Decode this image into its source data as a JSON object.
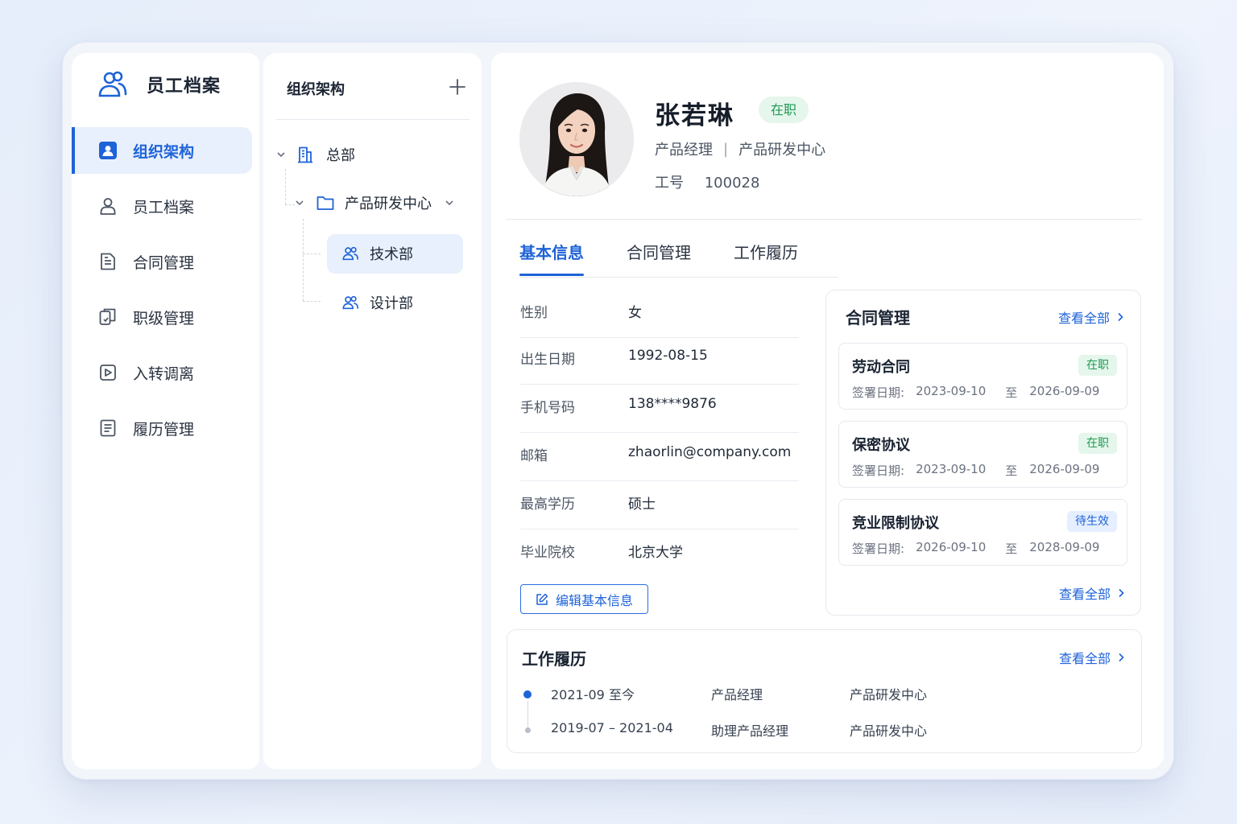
{
  "app": {
    "title": "员工档案",
    "brand_icon": "users-icon",
    "accent": "#1e63d8"
  },
  "sidebar": {
    "items": [
      {
        "label": "组织架构",
        "icon": "org-icon",
        "active": true
      },
      {
        "label": "员工档案",
        "icon": "user-icon",
        "active": false
      },
      {
        "label": "合同管理",
        "icon": "contract-icon",
        "active": false
      },
      {
        "label": "职级管理",
        "icon": "rank-icon",
        "active": false
      },
      {
        "label": "入转调离",
        "icon": "transfer-icon",
        "active": false
      },
      {
        "label": "履历管理",
        "icon": "resume-icon",
        "active": false
      }
    ]
  },
  "org_tree": {
    "title": "组织架构",
    "add_icon": "plus-icon",
    "nodes": [
      {
        "label": "总部",
        "icon": "building-icon",
        "expanded": true
      },
      {
        "label": "产品研发中心",
        "icon": "folder-icon",
        "expanded": true
      },
      {
        "label": "技术部",
        "icon": "team-icon",
        "selected": true
      },
      {
        "label": "设计部",
        "icon": "team-icon",
        "selected": false
      }
    ]
  },
  "employee": {
    "name": "张若琳",
    "status": "在职",
    "position": "产品经理",
    "department": "产品研发中心",
    "meta_separator": "|",
    "id_label": "工号",
    "id_value": "100028"
  },
  "tabs": [
    {
      "label": "基本信息",
      "active": true
    },
    {
      "label": "合同管理",
      "active": false
    },
    {
      "label": "工作履历",
      "active": false
    }
  ],
  "basic_info": [
    {
      "label": "性别",
      "value": "女"
    },
    {
      "label": "出生日期",
      "value": "1992-08-15"
    },
    {
      "label": "手机号码",
      "value": "138****9876"
    },
    {
      "label": "邮箱",
      "value": "zhaorlin@company.com"
    },
    {
      "label": "最高学历",
      "value": "硕士"
    },
    {
      "label": "毕业院校",
      "value": "北京大学"
    }
  ],
  "edit_button": "编辑基本信息",
  "contracts": {
    "title": "合同管理",
    "view_all": "查看全部",
    "date_label": "签署日期:",
    "to_label": "至",
    "items": [
      {
        "name": "劳动合同",
        "status": "在职",
        "status_color": "green",
        "start": "2023-09-10",
        "end": "2026-09-09"
      },
      {
        "name": "保密协议",
        "status": "在职",
        "status_color": "green",
        "start": "2023-09-10",
        "end": "2026-09-09"
      },
      {
        "name": "竞业限制协议",
        "status": "待生效",
        "status_color": "blue",
        "start": "2026-09-10",
        "end": "2028-09-09"
      }
    ],
    "view_all_bottom": "查看全部"
  },
  "work_history": {
    "title": "工作履历",
    "view_all": "查看全部",
    "items": [
      {
        "period": "2021-09 至今",
        "role": "产品经理",
        "department": "产品研发中心",
        "current": true
      },
      {
        "period": "2019-07 – 2021-04",
        "role": "助理产品经理",
        "department": "产品研发中心",
        "current": false
      }
    ]
  }
}
